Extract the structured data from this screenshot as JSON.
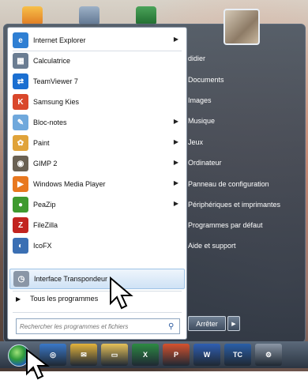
{
  "programs": [
    {
      "label": "Internet Explorer",
      "icon": "internet-explorer-icon",
      "color": "#2f7fd3",
      "glyph": "e",
      "submenu": true
    },
    {
      "label": "Calculatrice",
      "icon": "calculator-icon",
      "color": "#6b7d92",
      "glyph": "▦",
      "submenu": false
    },
    {
      "label": "TeamViewer 7",
      "icon": "teamviewer-icon",
      "color": "#1b6fd1",
      "glyph": "⇄",
      "submenu": false
    },
    {
      "label": "Samsung Kies",
      "icon": "samsung-kies-icon",
      "color": "#d9472b",
      "glyph": "K",
      "submenu": false
    },
    {
      "label": "Bloc-notes",
      "icon": "notepad-icon",
      "color": "#6fa8dc",
      "glyph": "✎",
      "submenu": true
    },
    {
      "label": "Paint",
      "icon": "paint-icon",
      "color": "#e0a33a",
      "glyph": "✿",
      "submenu": true
    },
    {
      "label": "GIMP 2",
      "icon": "gimp-icon",
      "color": "#6a6153",
      "glyph": "◉",
      "submenu": true
    },
    {
      "label": "Windows Media Player",
      "icon": "media-player-icon",
      "color": "#e8781f",
      "glyph": "▶",
      "submenu": true
    },
    {
      "label": "PeaZip",
      "icon": "peazip-icon",
      "color": "#3f9a2f",
      "glyph": "●",
      "submenu": true
    },
    {
      "label": "FileZilla",
      "icon": "filezilla-icon",
      "color": "#c2241f",
      "glyph": "Z",
      "submenu": false
    },
    {
      "label": "IcoFX",
      "icon": "icofx-icon",
      "color": "#3b6fb3",
      "glyph": "◐",
      "submenu": false
    },
    {
      "label": "Interface Transpondeur",
      "icon": "stopwatch-icon",
      "color": "#8a96a6",
      "glyph": "◷",
      "submenu": false
    }
  ],
  "all_programs": "Tous les programmes",
  "search_placeholder": "Rechercher les programmes et fichiers",
  "right_items": [
    "didier",
    "Documents",
    "Images",
    "Musique",
    "Jeux",
    "Ordinateur",
    "Panneau de configuration",
    "Périphériques et imprimantes",
    "Programmes par défaut",
    "Aide et support"
  ],
  "shutdown_label": "Arrêter",
  "taskbar_items": [
    {
      "name": "browser-icon",
      "color": "#3a78c9",
      "glyph": "◎"
    },
    {
      "name": "outlook-icon",
      "color": "#e3b43c",
      "glyph": "✉"
    },
    {
      "name": "explorer-folder-icon",
      "color": "#e6c25a",
      "glyph": "▭"
    },
    {
      "name": "excel-icon",
      "color": "#2d8a43",
      "glyph": "X"
    },
    {
      "name": "presentation-icon",
      "color": "#d6522e",
      "glyph": "P"
    },
    {
      "name": "word-icon",
      "color": "#2f5fb3",
      "glyph": "W"
    },
    {
      "name": "tc-icon",
      "color": "#2a5fa8",
      "glyph": "TC"
    },
    {
      "name": "tools-icon",
      "color": "#8c97a6",
      "glyph": "⚙"
    }
  ],
  "colors": {
    "menu_border": "#5d6b7c",
    "highlight": "#cfe2f5",
    "taskbar": "#2b3542"
  }
}
